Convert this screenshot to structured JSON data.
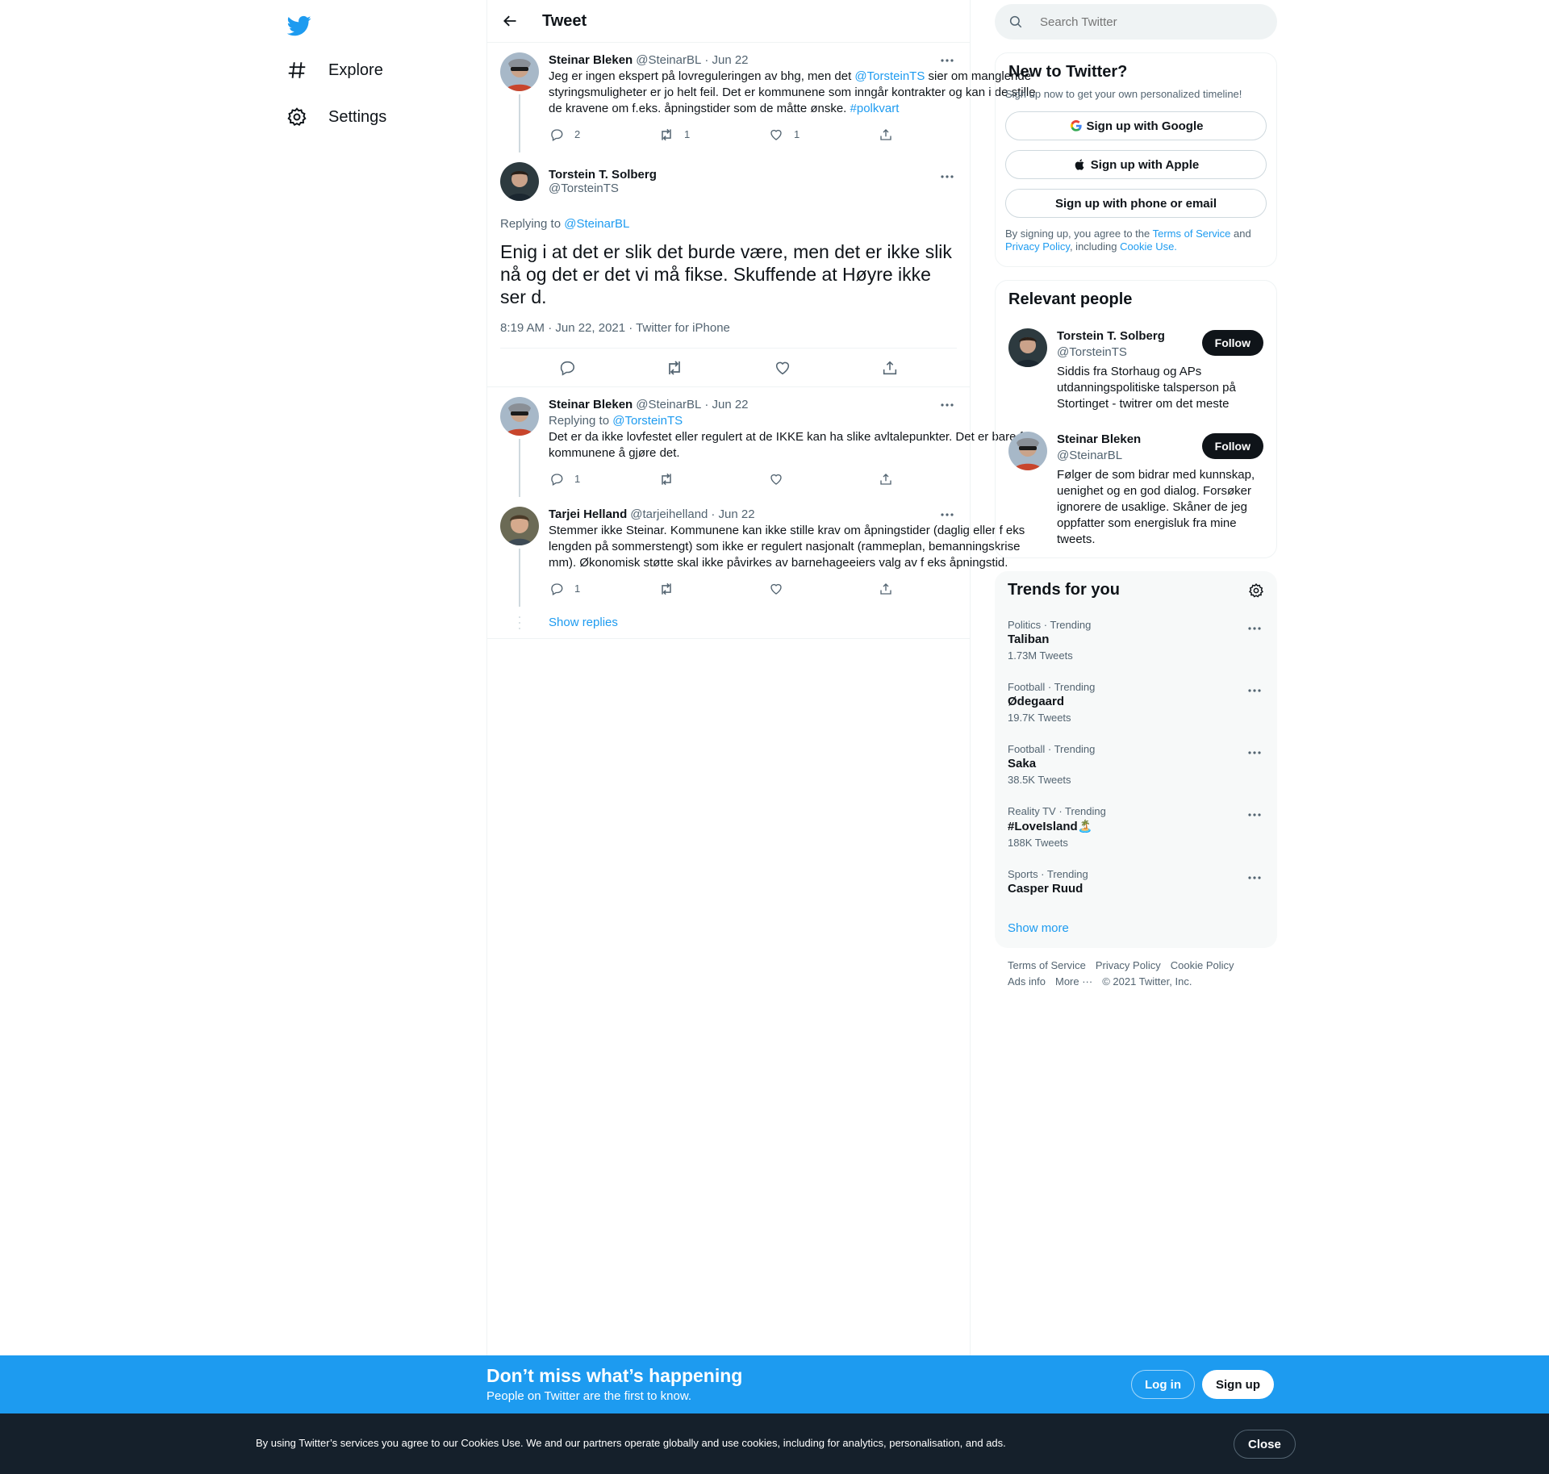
{
  "nav": {
    "explore": "Explore",
    "settings": "Settings"
  },
  "header": {
    "title": "Tweet"
  },
  "tweets": [
    {
      "name": "Steinar Bleken",
      "handle": "@SteinarBL",
      "date": "· Jun 22",
      "text_a": "Jeg er ingen ekspert på lovreguleringen av bhg, men det ",
      "mention": "@TorsteinTS",
      "text_b": " sier om manglende styringsmuligheter er jo helt feil. Det er kommunene som inngår kontrakter og kan i de stille de kravene om f.eks. åpningstider som de måtte ønske. ",
      "hashtag": "#polkvart",
      "replies": "2",
      "retweets": "1",
      "likes": "1"
    },
    {
      "name": "Steinar Bleken",
      "handle": "@SteinarBL",
      "date": "· Jun 22",
      "replying_label": "Replying to ",
      "replying_to": "@TorsteinTS",
      "text": "Det er da ikke lovfestet eller regulert at de IKKE kan ha slike avltalepunkter. Det er bare for kommunene å gjøre det.",
      "replies": "1",
      "retweets": "",
      "likes": ""
    },
    {
      "name": "Tarjei Helland",
      "handle": "@tarjeihelland",
      "date": "· Jun 22",
      "text": "Stemmer ikke Steinar. Kommunene kan ikke stille krav om åpningstider (daglig eller f eks lengden på sommerstengt) som ikke er regulert nasjonalt (rammeplan, bemanningskrise mm). Økonomisk støtte skal ikke påvirkes av barnehageeiers valg av f eks åpningstid.",
      "replies": "1",
      "retweets": "",
      "likes": ""
    }
  ],
  "focus": {
    "name": "Torstein T. Solberg",
    "handle": "@TorsteinTS",
    "replying_label": "Replying to ",
    "replying_to": "@SteinarBL",
    "text": "Enig i at det er slik det burde være, men det er ikke slik nå og det er det vi må fikse. Skuffende at Høyre ikke ser d.",
    "time": "8:19 AM · Jun 22, 2021 · Twitter for iPhone"
  },
  "show_replies": "Show replies",
  "search": {
    "placeholder": "Search Twitter"
  },
  "signup": {
    "title": "New to Twitter?",
    "sub": "Sign up now to get your own personalized timeline!",
    "google": "Sign up with Google",
    "apple": "Sign up with Apple",
    "phone": "Sign up with phone or email",
    "legal_a": "By signing up, you agree to the ",
    "terms": "Terms of Service",
    "legal_b": " and ",
    "privacy": "Privacy Policy",
    "legal_c": ", including ",
    "cookie": "Cookie Use."
  },
  "relevant": {
    "title": "Relevant people",
    "people": [
      {
        "name": "Torstein T. Solberg",
        "handle": "@TorsteinTS",
        "bio": "Siddis fra Storhaug og APs utdanningspolitiske talsperson på Stortinget - twitrer om det meste",
        "follow": "Follow"
      },
      {
        "name": "Steinar Bleken",
        "handle": "@SteinarBL",
        "bio": "Følger de som bidrar med kunnskap, uenighet og en god dialog. Forsøker ignorere de usaklige. Skåner de jeg oppfatter som energisluk fra mine tweets.",
        "follow": "Follow"
      }
    ]
  },
  "trends": {
    "title": "Trends for you",
    "items": [
      {
        "cat": "Politics · Trending",
        "name": "Taliban",
        "count": "1.73M Tweets"
      },
      {
        "cat": "Football · Trending",
        "name": "Ødegaard",
        "count": "19.7K Tweets"
      },
      {
        "cat": "Football · Trending",
        "name": "Saka",
        "count": "38.5K Tweets"
      },
      {
        "cat": "Reality TV · Trending",
        "name": "#LoveIsland🏝️",
        "count": "188K Tweets"
      },
      {
        "cat": "Sports · Trending",
        "name": "Casper Ruud",
        "count": ""
      }
    ],
    "show_more": "Show more"
  },
  "footer": {
    "terms": "Terms of Service",
    "privacy": "Privacy Policy",
    "cookie": "Cookie Policy",
    "ads": "Ads info",
    "more": "More ···",
    "copyright": "© 2021 Twitter, Inc."
  },
  "banner": {
    "title": "Don’t miss what’s happening",
    "sub": "People on Twitter are the first to know.",
    "login": "Log in",
    "signup": "Sign up"
  },
  "cookie": {
    "text": "By using Twitter’s services you agree to our Cookies Use. We and our partners operate globally and use cookies, including for analytics, personalisation, and ads.",
    "close": "Close"
  },
  "colors": {
    "accent": "#1d9bf0",
    "text": "#0f1419",
    "muted": "#536471",
    "dark": "#15202b"
  }
}
